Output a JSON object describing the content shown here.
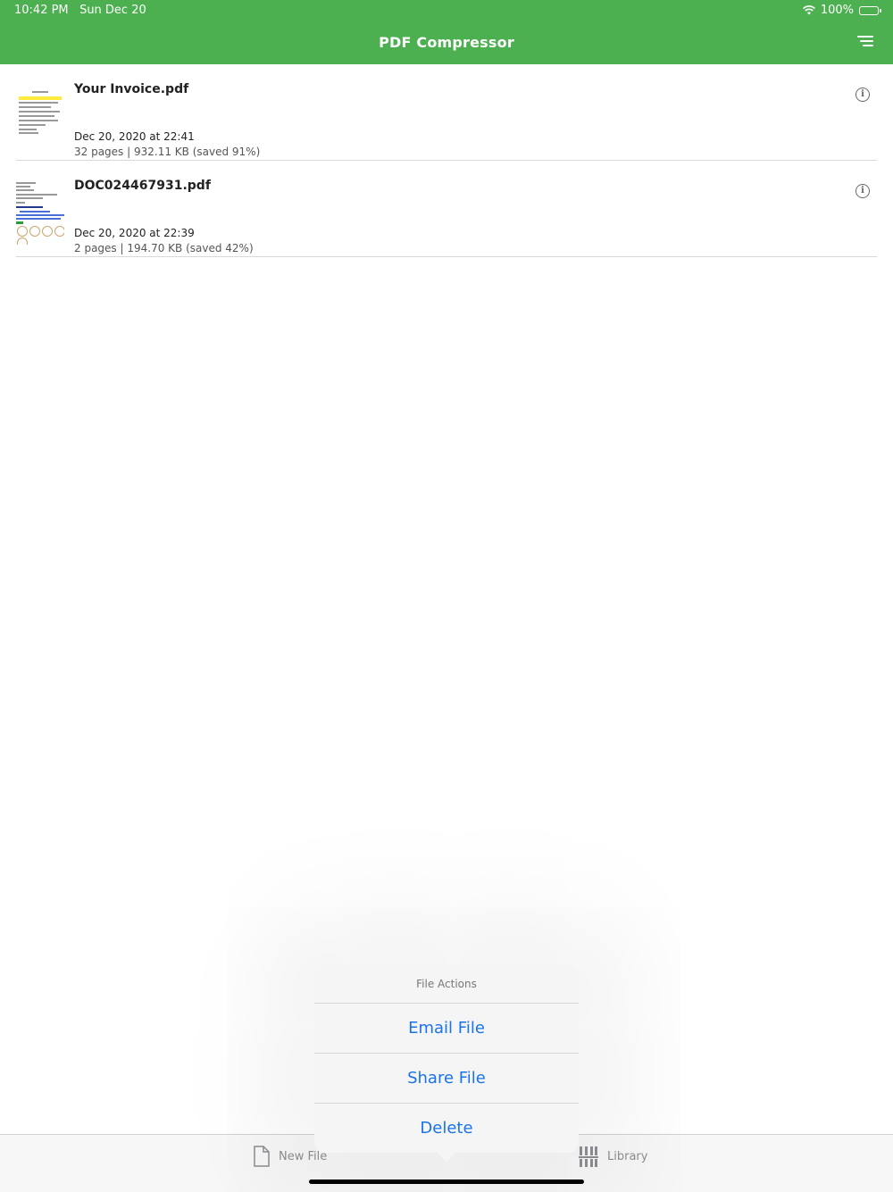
{
  "status_bar": {
    "time": "10:42 PM",
    "date": "Sun Dec 20",
    "battery": "100%"
  },
  "header": {
    "title": "PDF Compressor",
    "bg_color": "#4caf50",
    "menu_icon": "menu-icon"
  },
  "files": [
    {
      "name": "Your Invoice.pdf",
      "date": "Dec 20, 2020 at 22:41",
      "meta": "32 pages | 932.11 KB (saved 91%)"
    },
    {
      "name": "DOC024467931.pdf",
      "date": "Dec 20, 2020 at 22:39",
      "meta": "2 pages | 194.70 KB (saved 42%)"
    }
  ],
  "popover": {
    "title": "File Actions",
    "actions": [
      "Email File",
      "Share File",
      "Delete"
    ],
    "action_color": "#1a73e8"
  },
  "tab_bar": {
    "new_file": "New File",
    "library": "Library"
  }
}
